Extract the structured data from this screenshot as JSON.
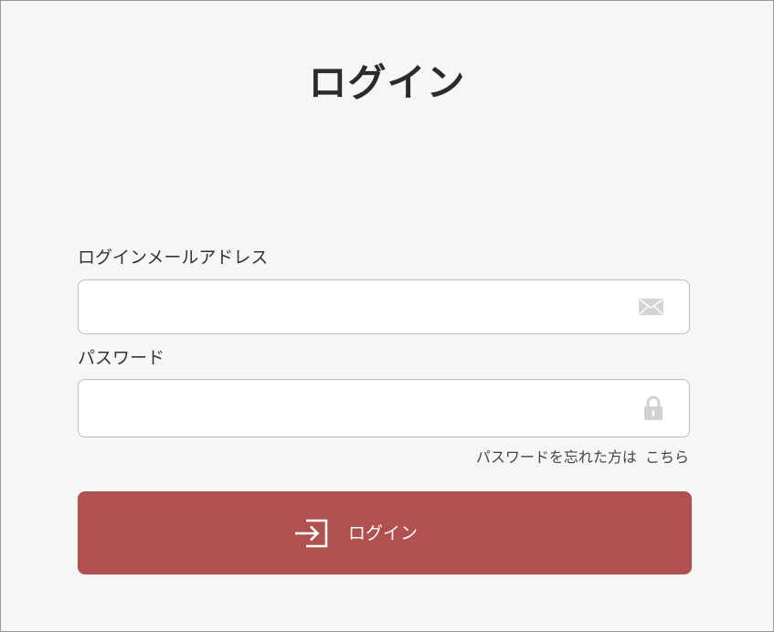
{
  "page": {
    "title": "ログイン"
  },
  "email": {
    "label": "ログインメールアドレス",
    "value": "",
    "placeholder": "",
    "icon": "mail-icon"
  },
  "password": {
    "label": "パスワード",
    "value": "",
    "placeholder": "",
    "icon": "lock-icon"
  },
  "forgot": {
    "text": "パスワードを忘れた方は",
    "link_label": "こちら"
  },
  "submit": {
    "label": "ログイン",
    "icon": "login-enter-icon"
  },
  "colors": {
    "background": "#f6f6f6",
    "button": "#b15050",
    "input_icon": "#d2d2d2"
  }
}
